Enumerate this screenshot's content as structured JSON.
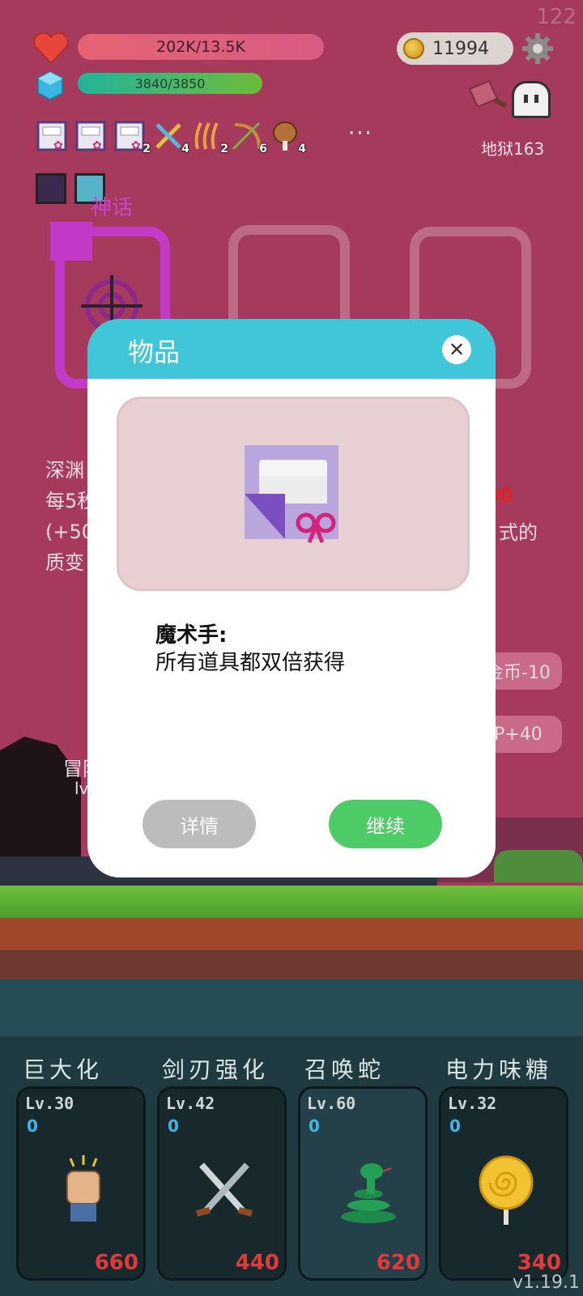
{
  "hud": {
    "fps": "122",
    "hp_text": "202K/13.5K",
    "xp_text": "3840/3850",
    "coins": "11994",
    "stage_label": "地狱163"
  },
  "inventory": [
    {
      "icon": "magic-hand-scroll-icon",
      "count": ""
    },
    {
      "icon": "magic-hand-scroll-icon",
      "count": ""
    },
    {
      "icon": "magic-hand-scroll-icon",
      "count": "2"
    },
    {
      "icon": "crossed-tools-icon",
      "count": "4"
    },
    {
      "icon": "claw-marks-icon",
      "count": "2"
    },
    {
      "icon": "bow-arrow-icon",
      "count": "6"
    },
    {
      "icon": "meat-leg-icon",
      "count": "4"
    }
  ],
  "more_label": "···",
  "myth_label": "神话",
  "background_text": {
    "left_lines": [
      "深渊",
      "每5秒",
      "(+50",
      "质变"
    ],
    "red_value": "00",
    "right_text": "式的",
    "pill1": "金币-10",
    "pill2": "P+40",
    "adventurer_label": "冒险",
    "adventurer_sub": "lv"
  },
  "modal": {
    "title": "物品",
    "close_symbol": "✕",
    "item_name": "魔术手:",
    "item_desc": "所有道具都双倍获得",
    "detail_label": "详情",
    "continue_label": "继续"
  },
  "skills": [
    {
      "title": "巨大化",
      "level": "Lv.30",
      "zero": "0",
      "cost": "660",
      "icon": "fist-icon"
    },
    {
      "title": "剑刃强化",
      "level": "Lv.42",
      "zero": "0",
      "cost": "440",
      "icon": "crossed-swords-icon"
    },
    {
      "title": "召唤蛇",
      "level": "Lv.60",
      "zero": "0",
      "cost": "620",
      "icon": "snake-icon"
    },
    {
      "title": "电力味糖",
      "level": "Lv.32",
      "zero": "0",
      "cost": "340",
      "icon": "lollipop-icon"
    }
  ],
  "version": "v1.19.1",
  "colors": {
    "background": "#a63a5c",
    "modal_header": "#3fc6d8",
    "continue_button": "#4dcb66",
    "detail_button": "#bcbcbc",
    "cost_red": "#e23a3a",
    "myth_purple": "#c43ac8"
  }
}
